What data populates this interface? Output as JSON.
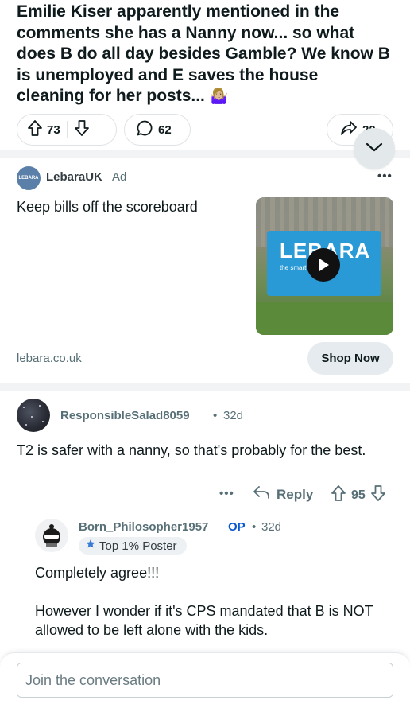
{
  "post": {
    "title": "Emilie Kiser apparently mentioned in the comments she has a Nanny now... so what does B do all day besides Gamble? We know B is unemployed and E saves the house cleaning for her posts...",
    "title_emoji": "🤷🏼‍♀️",
    "upvotes": "73",
    "comments": "62",
    "shares": "20"
  },
  "ad": {
    "advertiser": "LebaraUK",
    "avatar_text": "LEBARA",
    "tag": "Ad",
    "more": "•••",
    "headline": "Keep bills off the scoreboard",
    "media_brand": "LEBARA",
    "media_sub": "the smart network",
    "domain": "lebara.co.uk",
    "cta": "Shop Now"
  },
  "comments": [
    {
      "user": "ResponsibleSalad8059",
      "dot": "•",
      "time": "32d",
      "text": "T2 is safer with a nanny, so that's probably for the best.",
      "more": "•••",
      "reply_label": "Reply",
      "votes": "95"
    },
    {
      "user": "Born_Philosopher1957",
      "op_badge": "OP",
      "dot": "•",
      "time": "32d",
      "flair": "Top 1% Poster",
      "text_1": "Completely agree!!!",
      "text_2": "However I wonder if it's CPS mandated that B is NOT allowed to be left alone with the kids."
    }
  ],
  "composer": {
    "placeholder": "Join the conversation"
  },
  "colors": {
    "text_primary": "#0f1a1c",
    "text_secondary": "#576f76",
    "op_blue": "#0a58d0",
    "pill_border": "#dfe3e6",
    "button_bg": "#e5ebee",
    "divider": "#f1f3f4"
  },
  "icons": [
    "upvote-icon",
    "downvote-icon",
    "comment-icon",
    "share-icon",
    "chevron-down-icon",
    "reply-icon",
    "flair-icon",
    "play-icon"
  ]
}
